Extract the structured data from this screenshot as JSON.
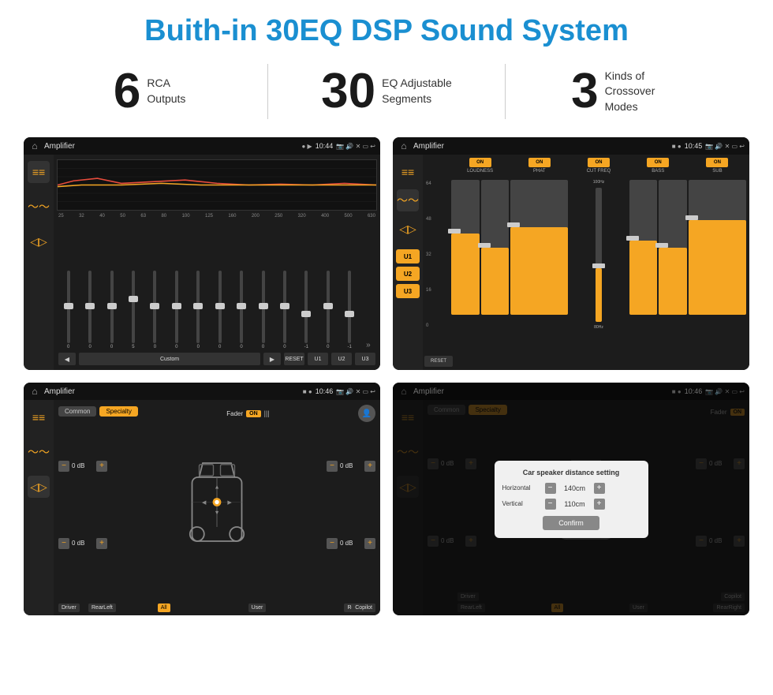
{
  "page": {
    "title": "Buith-in 30EQ DSP Sound System",
    "features": [
      {
        "number": "6",
        "label": "RCA\nOutputs"
      },
      {
        "number": "30",
        "label": "EQ Adjustable\nSegments"
      },
      {
        "number": "3",
        "label": "Kinds of\nCrossover Modes"
      }
    ]
  },
  "screen1": {
    "title": "Amplifier",
    "time": "10:44",
    "frequencies": [
      "25",
      "32",
      "40",
      "50",
      "63",
      "80",
      "100",
      "125",
      "160",
      "200",
      "250",
      "320",
      "400",
      "500",
      "630"
    ],
    "sliders": [
      "0",
      "0",
      "0",
      "5",
      "0",
      "0",
      "0",
      "0",
      "0",
      "0",
      "0",
      "-1",
      "0",
      "-1"
    ],
    "presets": [
      "Custom",
      "RESET",
      "U1",
      "U2",
      "U3"
    ]
  },
  "screen2": {
    "title": "Amplifier",
    "time": "10:45",
    "modes": [
      "U1",
      "U2",
      "U3"
    ],
    "channels": [
      "LOUDNESS",
      "PHAT",
      "CUT FREQ",
      "BASS",
      "SUB"
    ]
  },
  "screen3": {
    "title": "Amplifier",
    "time": "10:46",
    "tabs": [
      "Common",
      "Specialty"
    ],
    "faderLabel": "Fader",
    "onLabel": "ON",
    "dbValues": [
      "0 dB",
      "0 dB",
      "0 dB",
      "0 dB"
    ],
    "bottomLabels": [
      "Driver",
      "All",
      "User",
      "RearRight",
      "RearLeft",
      "Copilot"
    ]
  },
  "screen4": {
    "title": "Amplifier",
    "time": "10:46",
    "tabs": [
      "Common",
      "Specialty"
    ],
    "dialog": {
      "title": "Car speaker distance setting",
      "horizontal_label": "Horizontal",
      "horizontal_value": "140cm",
      "vertical_label": "Vertical",
      "vertical_value": "110cm",
      "confirm_label": "Confirm"
    },
    "bottomLabels": [
      "Driver",
      "All",
      "User",
      "RearRight",
      "RearLeft",
      "Copilot"
    ]
  }
}
